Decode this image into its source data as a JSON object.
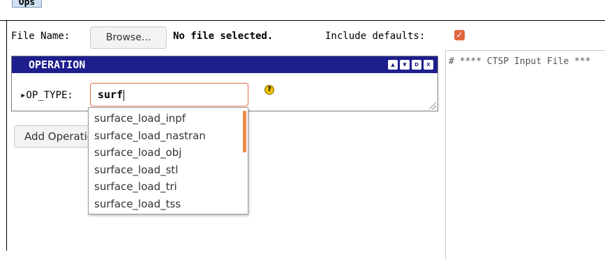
{
  "tab": {
    "label": "Ops"
  },
  "file_row": {
    "label": "File Name:",
    "browse_label": "Browse...",
    "status": "No file selected.",
    "include_defaults_label": "Include defaults:",
    "include_defaults_checked": true
  },
  "operation_panel": {
    "title": "OPERATION",
    "header_buttons": [
      "▲",
      "▼",
      "D",
      "X"
    ],
    "op_type_label": "▸OP_TYPE:",
    "op_type_value": "surf",
    "help_icon": "?"
  },
  "add_operation": {
    "label": "Add Operation"
  },
  "autocomplete": {
    "items": [
      "surface_load_inpf",
      "surface_load_nastran",
      "surface_load_obj",
      "surface_load_stl",
      "surface_load_tri",
      "surface_load_tss"
    ]
  },
  "editor": {
    "first_line": "# **** CTSP Input File ***"
  },
  "colors": {
    "header_bg": "#1e1e8f",
    "accent": "#e0673e"
  }
}
